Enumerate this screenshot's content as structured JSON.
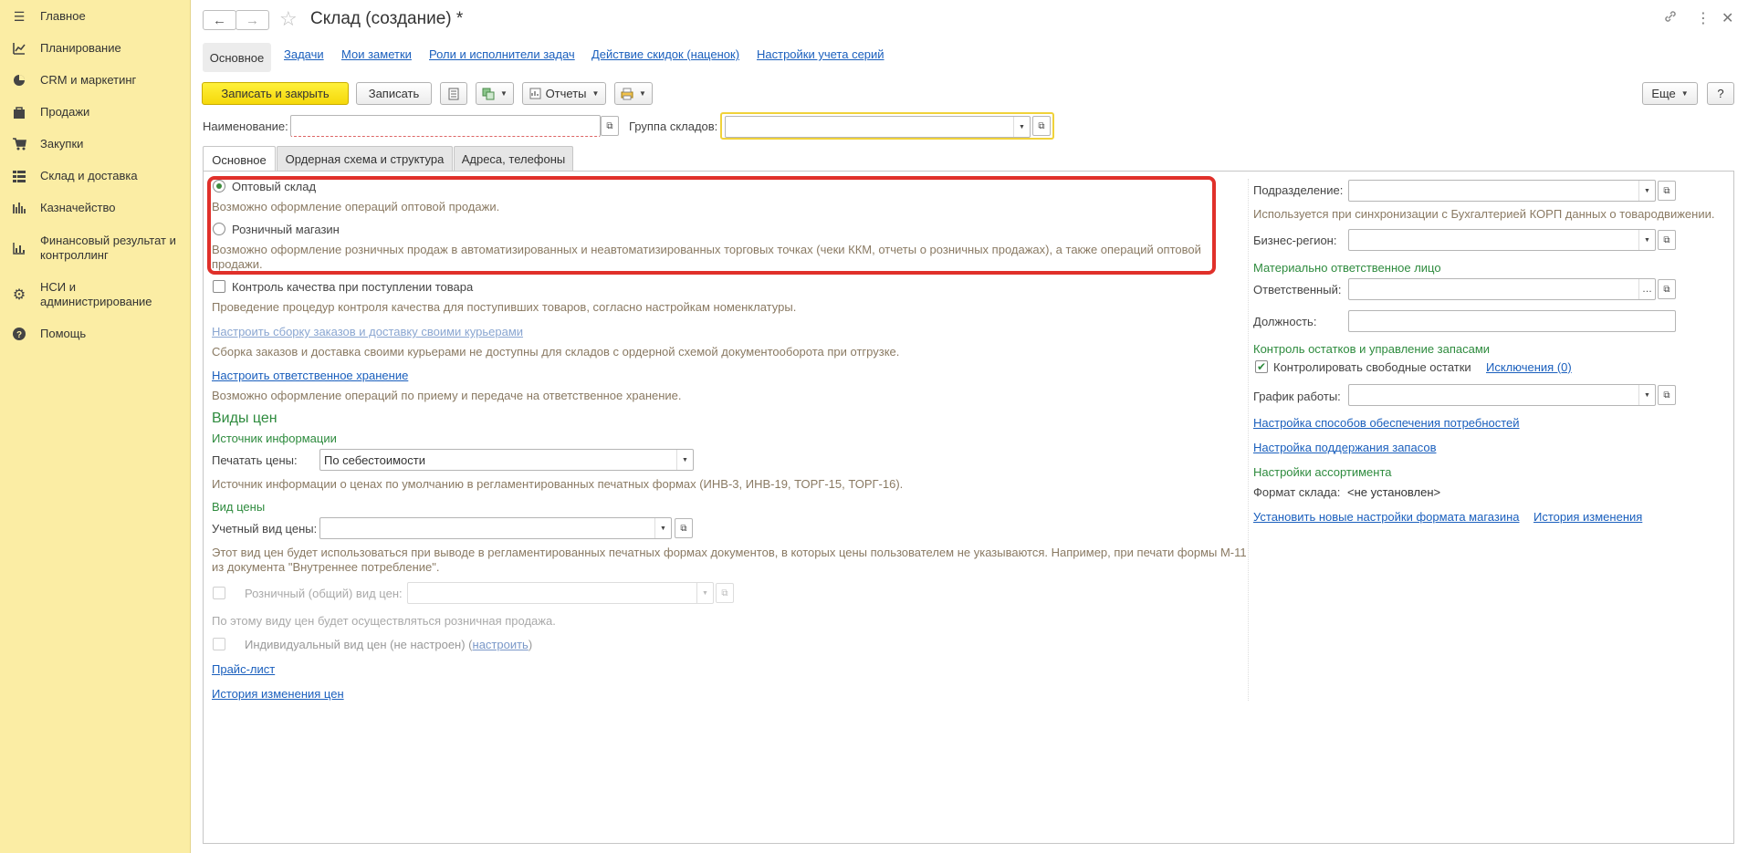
{
  "sidebar": {
    "items": [
      {
        "label": "Главное",
        "icon": "menu-icon"
      },
      {
        "label": "Планирование",
        "icon": "planning-icon"
      },
      {
        "label": "CRM и маркетинг",
        "icon": "pie-chart-icon"
      },
      {
        "label": "Продажи",
        "icon": "bag-icon"
      },
      {
        "label": "Закупки",
        "icon": "cart-icon"
      },
      {
        "label": "Склад и доставка",
        "icon": "grid-icon"
      },
      {
        "label": "Казначейство",
        "icon": "treasury-icon"
      },
      {
        "label": "Финансовый результат и контроллинг",
        "icon": "bar-chart-icon"
      },
      {
        "label": "НСИ и администрирование",
        "icon": "gear-icon"
      },
      {
        "label": "Помощь",
        "icon": "help-icon"
      }
    ]
  },
  "header": {
    "title": "Склад (создание) *",
    "back_icon": "←",
    "forward_icon": "→",
    "star_icon": "☆",
    "link_icon": "🔗",
    "more_icon": "⋮",
    "close_icon": "✕"
  },
  "top_tabs": [
    "Основное",
    "Задачи",
    "Мои заметки",
    "Роли и исполнители задач",
    "Действие скидок (наценок)",
    "Настройки учета серий"
  ],
  "toolbar": {
    "save_close": "Записать и закрыть",
    "save": "Записать",
    "reports": "Отчеты",
    "more": "Еще",
    "help": "?"
  },
  "form": {
    "name_label": "Наименование:",
    "name_value": "",
    "group_label": "Группа складов:",
    "group_value": ""
  },
  "sub_tabs": [
    "Основное",
    "Ордерная схема и структура",
    "Адреса, телефоны"
  ],
  "left": {
    "radio_wholesale": "Оптовый склад",
    "radio_wholesale_desc": "Возможно оформление операций оптовой продажи.",
    "radio_retail": "Розничный магазин",
    "radio_retail_desc_1": "Возможно оформление розничных продаж в автоматизированных и неавтоматизированных торговых точках (чеки ККМ, отчеты о розничных продажах), а также операций оптовой",
    "radio_retail_desc_2": "продажи.",
    "quality_control": "Контроль качества при поступлении товара",
    "quality_control_desc": "Проведение процедур контроля качества для поступивших товаров, согласно настройкам номенклатуры.",
    "courier_link": "Настроить сборку заказов и доставку своими курьерами",
    "courier_desc": "Сборка заказов и доставка своими курьерами не доступны для складов с ордерной схемой документооборота при отгрузке.",
    "custody_link": "Настроить ответственное хранение",
    "custody_desc": "Возможно оформление операций по приему и передаче на ответственное хранение.",
    "price_types_title": "Виды цен",
    "info_source": "Источник информации",
    "print_prices_label": "Печатать цены:",
    "print_prices_value": "По себестоимости",
    "print_prices_desc": "Источник информации о ценах по умолчанию в регламентированных печатных формах (ИНВ-3, ИНВ-19, ТОРГ-15, ТОРГ-16).",
    "price_type_title": "Вид цены",
    "account_price_label": "Учетный вид цены:",
    "account_price_value": "",
    "account_price_desc_1": "Этот вид цен будет использоваться при выводе в регламентированных печатных формах документов, в которых цены пользователем не указываются. Например, при печати формы М-11",
    "account_price_desc_2": "из документа \"Внутреннее потребление\".",
    "retail_price_label": "Розничный (общий) вид цен:",
    "retail_price_desc": "По этому виду цен будет осуществляться розничная продажа.",
    "individual_price": "Индивидуальный вид цен (не настроен) (",
    "individual_price_link": "настроить",
    "individual_price_end": ")",
    "price_list_link": "Прайс-лист",
    "price_history_link": "История изменения цен"
  },
  "right": {
    "division_label": "Подразделение:",
    "division_desc": "Используется при синхронизации с Бухгалтерией КОРП данных о товародвижении.",
    "region_label": "Бизнес-регион:",
    "responsible_title": "Материально ответственное лицо",
    "responsible_label": "Ответственный:",
    "position_label": "Должность:",
    "stock_title": "Контроль остатков и управление запасами",
    "control_free": "Контролировать свободные остатки",
    "exceptions_link": "Исключения (0)",
    "schedule_label": "График работы:",
    "supply_link": "Настройка способов обеспечения потребностей",
    "stock_support_link": "Настройка поддержания запасов",
    "assortment_title": "Настройки ассортимента",
    "format_label": "Формат склада:",
    "format_value": "<не установлен>",
    "new_format_link": "Установить новые настройки формата магазина",
    "history_link": "История изменения"
  }
}
